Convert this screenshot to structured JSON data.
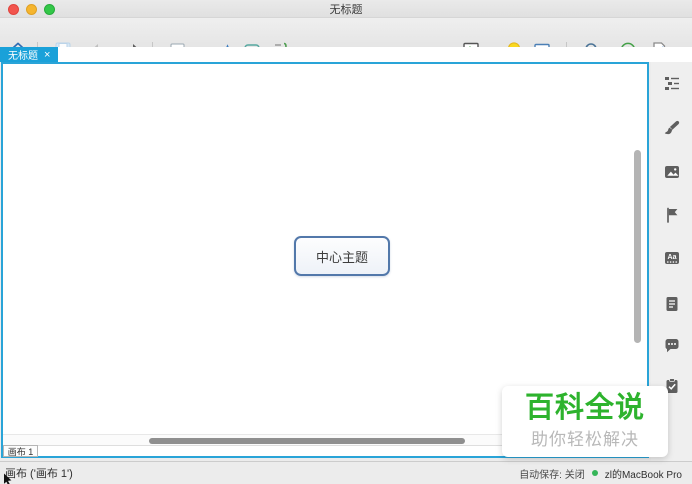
{
  "window": {
    "title": "无标题"
  },
  "toolbar": {
    "items": [
      "home",
      "save",
      "undo",
      "redo",
      "insert-topic",
      "relationship",
      "boundary",
      "summary",
      "more",
      "presentation",
      "idea",
      "slide-notes",
      "zoom-search",
      "share",
      "export"
    ]
  },
  "tabbar": {
    "active_tab": "无标题",
    "close_glyph": "×"
  },
  "canvas": {
    "central_topic": "中心主题"
  },
  "sidebar": {
    "aa_label": "Aa",
    "items": [
      "format",
      "theme-brush",
      "image",
      "marker-flag",
      "sticker",
      "notes",
      "comment",
      "task"
    ]
  },
  "sheet_bar": {
    "active_sheet": "画布 1"
  },
  "status_bar": {
    "sheet_info": "画布 ('画布 1')",
    "autosave": "自动保存: 关闭",
    "device": "zl的MacBook Pro"
  },
  "watermark": {
    "title": "百科全说",
    "subtitle": "助你轻松解决"
  },
  "colors": {
    "tab_accent": "#1aa1d9",
    "canvas_border": "#29a4d8",
    "topic_border": "#5278aa",
    "watermark_green": "#2db32d",
    "share_green": "#43a047",
    "bulb_yellow": "#f9d81f"
  }
}
